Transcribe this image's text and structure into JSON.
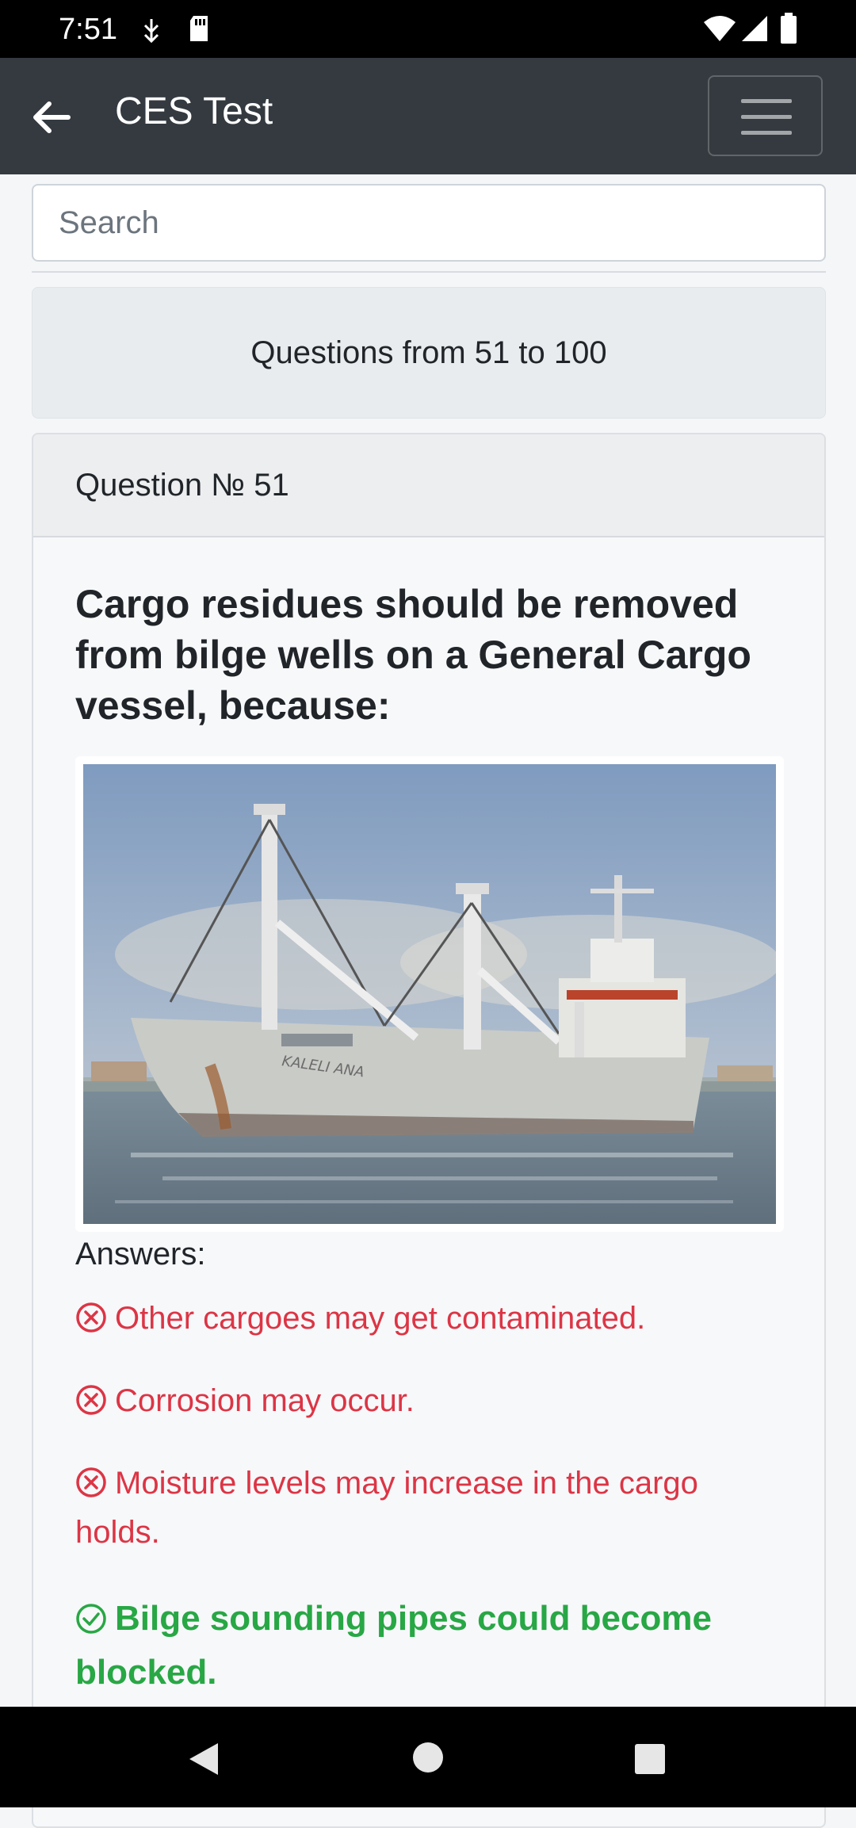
{
  "status_bar": {
    "time": "7:51",
    "icons": [
      "usb-debug-icon",
      "sd-card-icon",
      "wifi-icon",
      "cell-signal-icon",
      "battery-icon"
    ]
  },
  "app_bar": {
    "title": "CES Test",
    "back_icon": "arrow-left-icon",
    "menu_icon": "hamburger-menu-icon"
  },
  "search": {
    "placeholder": "Search",
    "value": ""
  },
  "range": {
    "label": "Questions from 51 to 100"
  },
  "question": {
    "header": "Question № 51",
    "text": "Cargo residues should be removed from bilge wells on a General Cargo vessel, because:",
    "answers_label": "Answers:",
    "answers": [
      {
        "text": "Other cargoes may get contaminated.",
        "correct": false
      },
      {
        "text": "Corrosion may occur.",
        "correct": false
      },
      {
        "text": "Moisture levels may increase in the cargo holds.",
        "correct": false
      },
      {
        "text": "Bilge sounding pipes could become blocked.",
        "correct": true
      }
    ]
  },
  "colors": {
    "app_bar": "#343a40",
    "wrong": "#dc3545",
    "correct": "#28a745"
  },
  "nav_bar": {
    "icons": [
      "nav-back-icon",
      "nav-home-icon",
      "nav-recents-icon"
    ]
  }
}
